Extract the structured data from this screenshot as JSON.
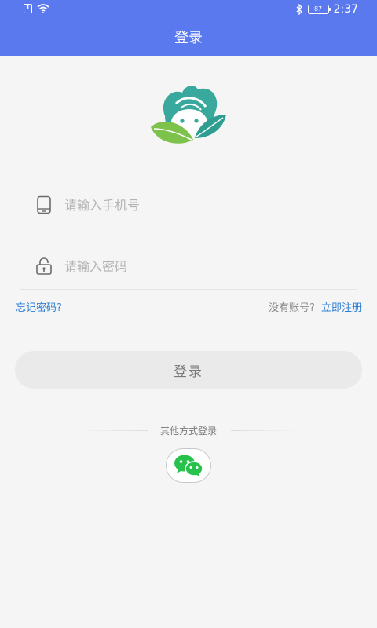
{
  "status_bar": {
    "sim_label": "1",
    "battery_level": "87",
    "time": "2:37"
  },
  "header": {
    "title": "登录"
  },
  "form": {
    "phone_placeholder": "请输入手机号",
    "password_placeholder": "请输入密码"
  },
  "links": {
    "forgot_password": "忘记密码?",
    "no_account": "没有账号?",
    "register": "立即注册"
  },
  "login_button_label": "登录",
  "other_login": {
    "divider_text": "其他方式登录"
  },
  "icons": {
    "logo": "leaf-face-logo",
    "phone": "mobile-phone-icon",
    "lock": "lock-icon",
    "wechat": "wechat-icon",
    "wifi": "wifi-icon",
    "bluetooth": "bluetooth-icon"
  },
  "colors": {
    "header_background": "#5b79ef",
    "link": "#2f7fd4",
    "logo_teal": "#3aa99d",
    "logo_green": "#7cc24b",
    "wechat_green": "#27c24c"
  }
}
